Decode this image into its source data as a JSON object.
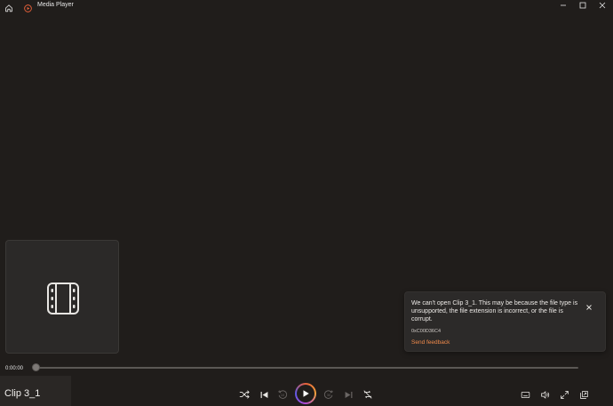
{
  "app": {
    "title": "Media Player"
  },
  "toast": {
    "message": "We can't open Clip 3_1. This may be because the file type is unsupported, the file extension is incorrect, or the file is corrupt.",
    "error_code": "0xC00D36C4",
    "feedback_link": "Send feedback"
  },
  "player": {
    "current_time": "0:00:00",
    "progress": 0,
    "clip_name": "Clip 3_1"
  },
  "colors": {
    "accent": "#f08a4b",
    "background": "#201d1b"
  }
}
